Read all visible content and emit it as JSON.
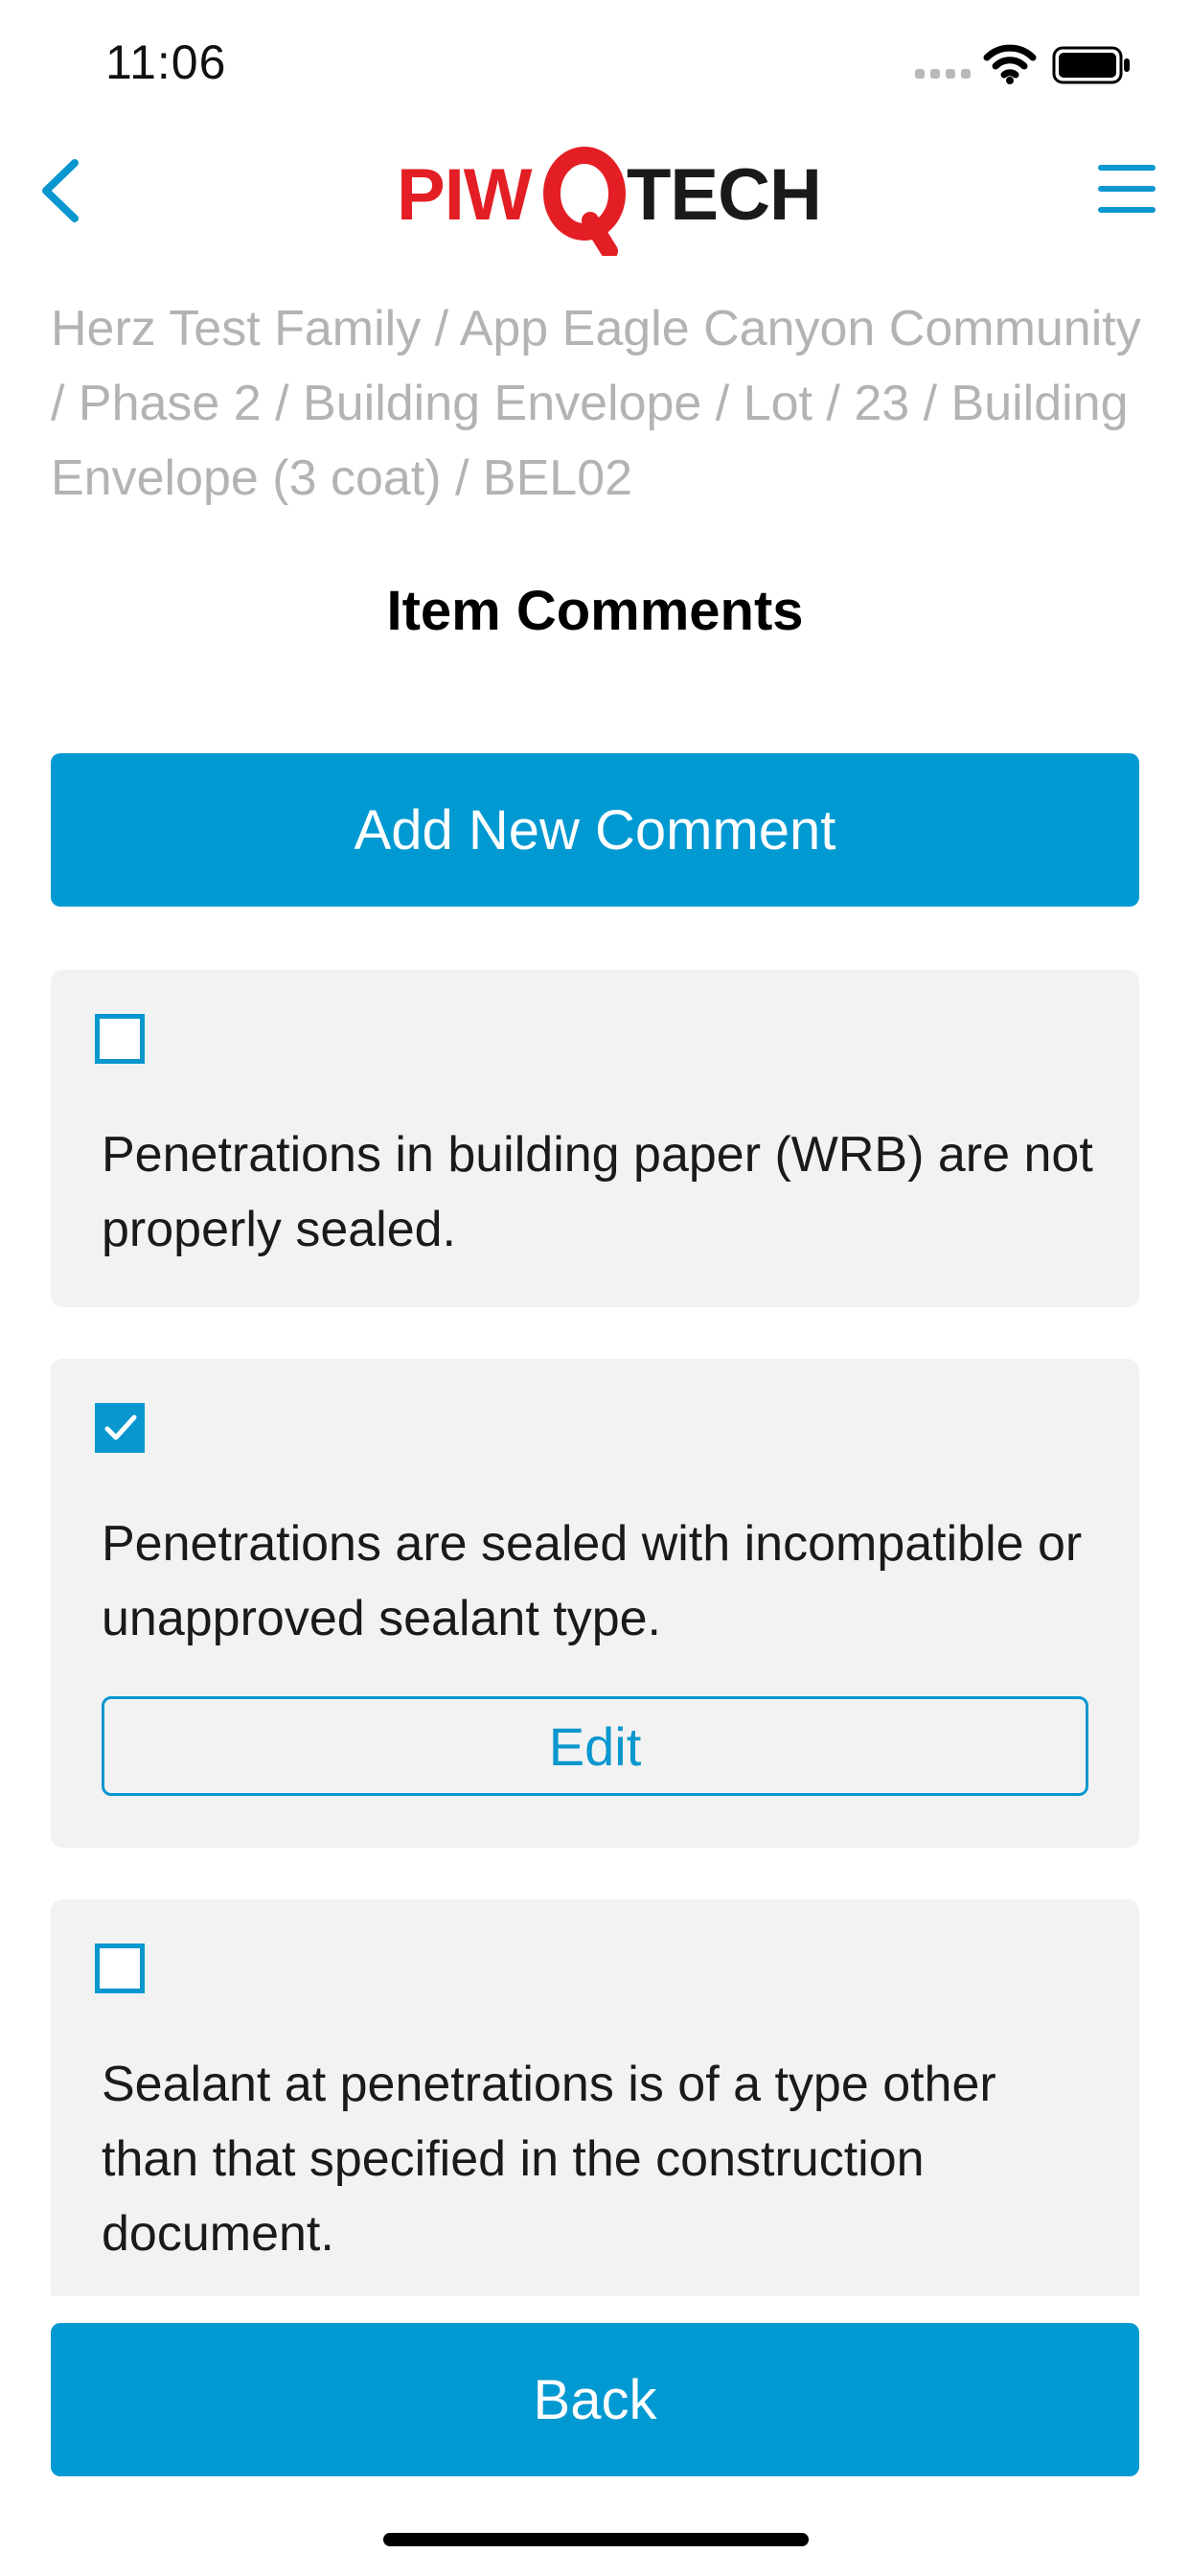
{
  "status_bar": {
    "time": "11:06"
  },
  "nav": {
    "logo": {
      "left": "PIW",
      "center": "Q",
      "right": "TECH"
    }
  },
  "breadcrumb": "Herz Test Family / App Eagle Canyon Community / Phase 2 / Building Envelope / Lot / 23 / Building Envelope (3 coat) / BEL02",
  "title": "Item Comments",
  "add_button_label": "Add New Comment",
  "comments": [
    {
      "text": "Penetrations in building paper (WRB) are not properly sealed.",
      "checked": false
    },
    {
      "text": "Penetrations are sealed with incompatible or unapproved sealant type.",
      "checked": true,
      "edit_label": "Edit"
    },
    {
      "text": "Sealant at penetrations is of a type other than that specified in the construction document.",
      "checked": false
    }
  ],
  "back_button_label": "Back",
  "colors": {
    "primary": "#0099d2",
    "logo_red": "#e31e24",
    "card_bg": "#f2f2f2",
    "breadcrumb_text": "#b3b3b3"
  },
  "icons": {
    "back": "chevron-left-icon",
    "menu": "hamburger-menu-icon",
    "check": "checkmark-icon"
  }
}
